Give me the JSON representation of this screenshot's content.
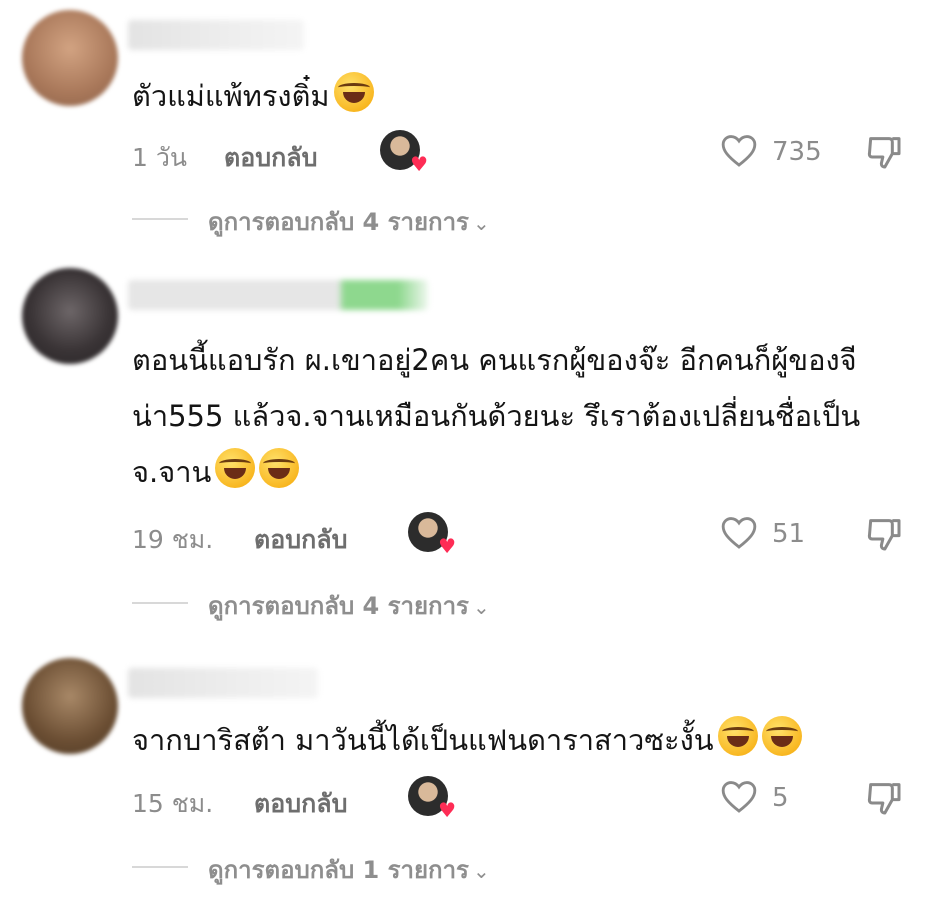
{
  "comments": [
    {
      "text": "ตัวแม่แพ้ทรงติ๋ม",
      "emojis": [
        "laughing-tears"
      ],
      "time": "1 วัน",
      "reply_label": "ตอบกลับ",
      "likes": "735",
      "view_replies": "ดูการตอบกลับ 4 รายการ",
      "avatar_color": "#b48a6e"
    },
    {
      "text": "ตอนนี้แอบรัก ผ.เขาอยู่2คน คนแรกผู้ของจ๊ะ อีกคนก็ผู้ของจีน่า555 แล้วจ.จานเหมือนกันด้วยนะ รึเราต้องเปลี่ยนชื่อเป็นจ.จาน",
      "emojis": [
        "rolling-laughing",
        "rolling-laughing"
      ],
      "time": "19 ชม.",
      "reply_label": "ตอบกลับ",
      "likes": "51",
      "view_replies": "ดูการตอบกลับ 4 รายการ",
      "avatar_color": "#3a3436"
    },
    {
      "text": "จากบาริสต้า มาวันนี้ได้เป็นแฟนดาราสาวซะงั้น",
      "emojis": [
        "laughing-tears",
        "laughing-tears"
      ],
      "time": "15 ชม.",
      "reply_label": "ตอบกลับ",
      "likes": "5",
      "view_replies": "ดูการตอบกลับ 1 รายการ",
      "avatar_color": "#6b4e33"
    }
  ],
  "colors": {
    "accent_heart": "#fe2c55",
    "meta_text": "#8c8c8c",
    "body_text": "#141414"
  },
  "icons": {
    "like": "heart-outline-icon",
    "dislike": "thumbs-down-icon",
    "chevron": "chevron-down-icon"
  }
}
